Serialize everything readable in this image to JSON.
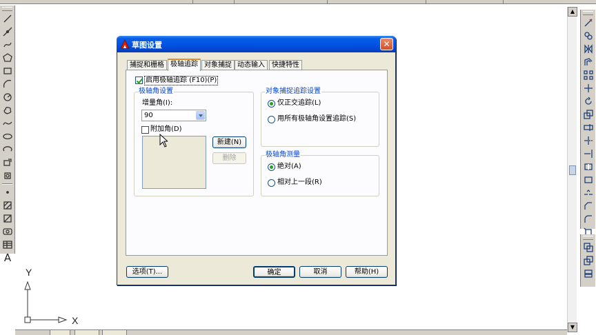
{
  "dialog": {
    "title": "草图设置",
    "close_label": "✕",
    "tabs": [
      {
        "label": "捕捉和栅格"
      },
      {
        "label": "极轴追踪"
      },
      {
        "label": "对象捕捉"
      },
      {
        "label": "动态输入"
      },
      {
        "label": "快捷特性"
      }
    ],
    "polar_toggle_label": "启用极轴追踪 (F10)(P)",
    "polar_group": {
      "title": "极轴角设置",
      "increment_label": "增量角(I):",
      "increment_value": "90",
      "additional_label": "附加角(D)",
      "new_button": "新建(N)",
      "delete_button": "删除"
    },
    "snap_tracking_group": {
      "title": "对象捕捉追踪设置",
      "option1": "仅正交追踪(L)",
      "option2": "用所有极轴角设置追踪(S)"
    },
    "measure_group": {
      "title": "极轴角测量",
      "option1": "绝对(A)",
      "option2": "相对上一段(R)"
    },
    "buttons": {
      "options": "选项(T)...",
      "ok": "确定",
      "cancel": "取消",
      "help": "帮助(H)"
    }
  },
  "ucs": {
    "x_label": "X",
    "y_label": "Y"
  },
  "colors": {
    "title_bar": "#0054e3",
    "dialog_bg": "#ece9d8",
    "group_title": "#0046d5",
    "check_mark": "#21a121"
  }
}
